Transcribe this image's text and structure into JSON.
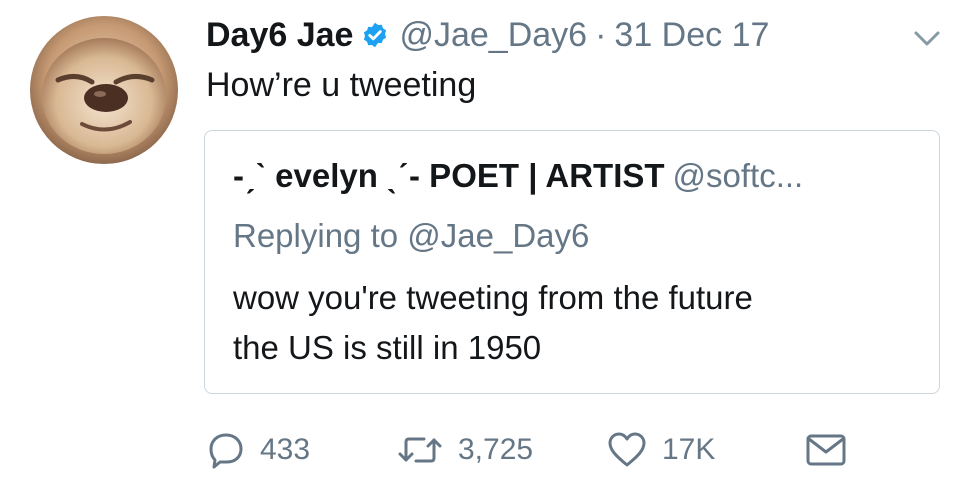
{
  "tweet": {
    "author": {
      "name": "Day6 Jae",
      "handle": "@Jae_Day6",
      "verified": true
    },
    "separator": "·",
    "date": "31 Dec 17",
    "text": "How’re u tweeting",
    "quoted": {
      "name": "-ˏˋ evelyn ˎˊ- POET | ARTIST",
      "handle": "@softc...",
      "replying_to": "Replying to @Jae_Day6",
      "text_lines": [
        "wow you're tweeting from the future",
        "the US is still in 1950"
      ]
    },
    "actions": {
      "replies": "433",
      "retweets": "3,725",
      "likes": "17K"
    }
  },
  "icons": {
    "verified": "verified-badge-icon",
    "caret": "chevron-down-icon",
    "reply": "reply-icon",
    "retweet": "retweet-icon",
    "like": "heart-icon",
    "dm": "envelope-icon"
  },
  "colors": {
    "primary_text": "#14171a",
    "secondary_text": "#657786",
    "verified_blue": "#1da1f2",
    "border": "#ccd6dd"
  }
}
